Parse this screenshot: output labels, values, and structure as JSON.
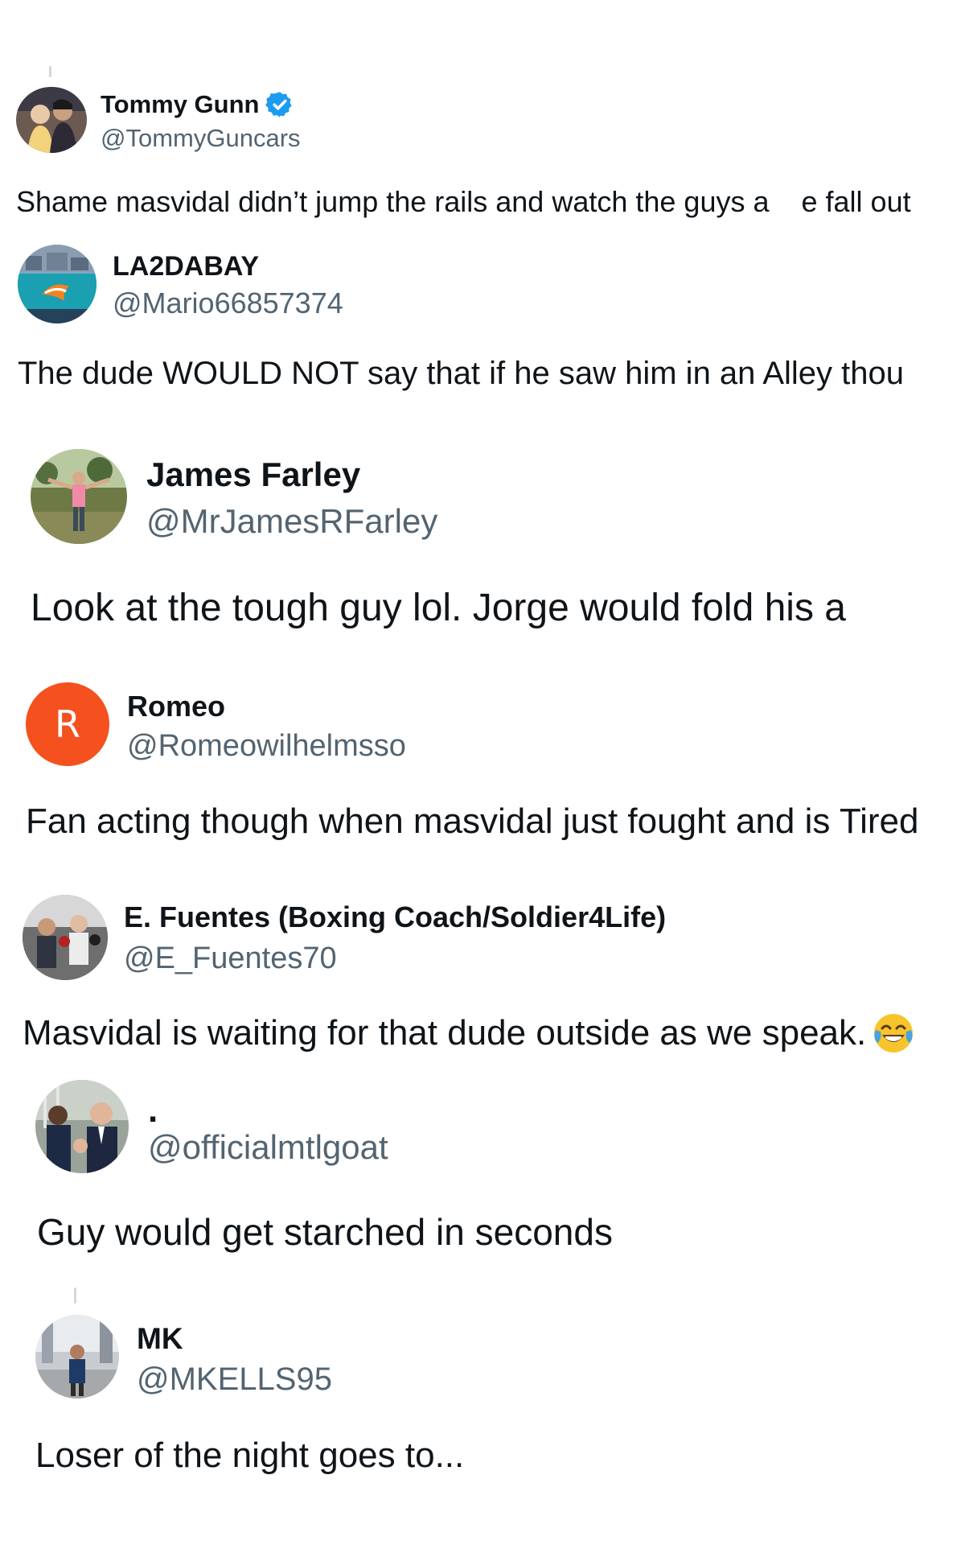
{
  "tweets": [
    {
      "name": "Tommy Gunn",
      "handle": "@TommyGuncars",
      "text": "Shame masvidal didn’t jump the rails and watch the guys a    e fall out",
      "verified": true,
      "avatar_icon": "profile-photo-couple"
    },
    {
      "name": "LA2DABAY",
      "handle": "@Mario66857374",
      "text": "The dude WOULD NOT say that if he saw him in an Alley thou",
      "avatar_icon": "profile-photo-dolphins-flag"
    },
    {
      "name": "James Farley",
      "handle": "@MrJamesRFarley",
      "text": "Look at the tough guy lol. Jorge would fold his a",
      "avatar_icon": "profile-photo-man-outdoors"
    },
    {
      "name": "Romeo",
      "handle": "@Romeowilhelmsso",
      "text": "Fan acting though when masvidal just fought and is Tired",
      "avatar_letter": "R",
      "avatar_color": "#f4511e"
    },
    {
      "name": "E. Fuentes (Boxing Coach/Soldier4Life)",
      "handle": "@E_Fuentes70",
      "text": "Masvidal is waiting for that dude outside as we speak.",
      "emoji": "face-with-tears-of-joy",
      "avatar_icon": "profile-photo-boxing-gym"
    },
    {
      "name": ".",
      "handle": "@officialmtlgoat",
      "text": "Guy would get starched in seconds",
      "avatar_icon": "profile-photo-men-in-suits"
    },
    {
      "name": "MK",
      "handle": "@MKELLS95",
      "text": "Loser of the night goes to...",
      "avatar_icon": "profile-photo-street"
    }
  ],
  "colors": {
    "verified_blue": "#1d9bf0",
    "handle_gray": "#536471",
    "text_dark": "#0f1419"
  }
}
